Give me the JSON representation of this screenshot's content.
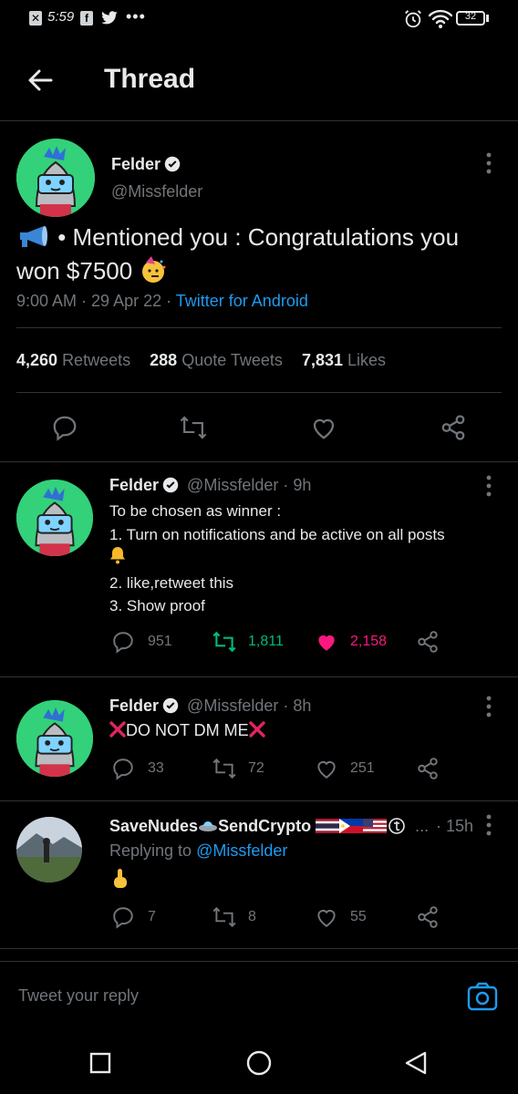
{
  "status_bar": {
    "time": "5:59",
    "battery": "32"
  },
  "header": {
    "title": "Thread"
  },
  "main_tweet": {
    "author_name": "Felder",
    "author_handle": "@Missfelder",
    "text_prefix": "• Mentioned you : Congratulations you",
    "text_line2": "won $7500",
    "meta_time_date": "9:00 AM · 29 Apr 22 · ",
    "meta_source": "Twitter for Android",
    "stats": {
      "retweets_count": "4,260",
      "retweets_label": "Retweets",
      "quotes_count": "288",
      "quotes_label": "Quote Tweets",
      "likes_count": "7,831",
      "likes_label": "Likes"
    }
  },
  "replies": [
    {
      "author_name": "Felder",
      "author_handle": "@Missfelder · 9h",
      "lines": [
        "To be chosen as winner :",
        "1. Turn on notifications and be active on all posts",
        "2. like,retweet this",
        "3. Show proof"
      ],
      "reply_count": "951",
      "retweet_count": "1,811",
      "like_count": "2,158"
    },
    {
      "author_name": "Felder",
      "author_handle": "@Missfelder · 8h",
      "text": "DO NOT DM ME",
      "reply_count": "33",
      "retweet_count": "72",
      "like_count": "251"
    },
    {
      "author_name": "SaveNudes",
      "author_name_part2": "SendCrypto",
      "ellipsis": "...",
      "time": "· 15h",
      "replying_prefix": "Replying to ",
      "replying_handle": "@Missfelder",
      "reply_count": "7",
      "retweet_count": "8",
      "like_count": "55"
    }
  ],
  "reply_bar": {
    "placeholder": "Tweet your reply"
  },
  "colors": {
    "accent": "#1d9bf0",
    "retweet_green": "#00ba7c",
    "like_pink": "#f91880",
    "avatar_green": "#33d17a"
  }
}
